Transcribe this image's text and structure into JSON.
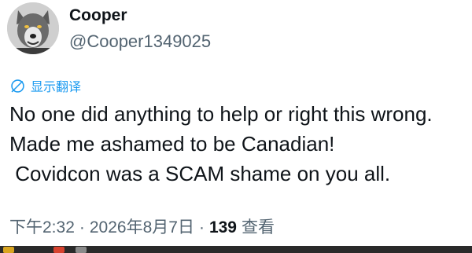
{
  "author": {
    "display_name": "Cooper",
    "handle": "@Cooper1349025",
    "avatar_icon": "wolf-avatar"
  },
  "translate": {
    "icon": "globe-translate-icon",
    "label": "显示翻译"
  },
  "tweet": {
    "lines": [
      "No one did anything to help or right this wrong.",
      "Made me ashamed to be Canadian!",
      " Covidcon was a SCAM shame on you all."
    ]
  },
  "meta": {
    "time": "下午2:32",
    "separator": "·",
    "date": "2026年8月7日",
    "views_count": "139",
    "views_label": "查看"
  },
  "colors": {
    "text": "#0f1419",
    "secondary": "#536471",
    "link": "#1d9bf0"
  }
}
